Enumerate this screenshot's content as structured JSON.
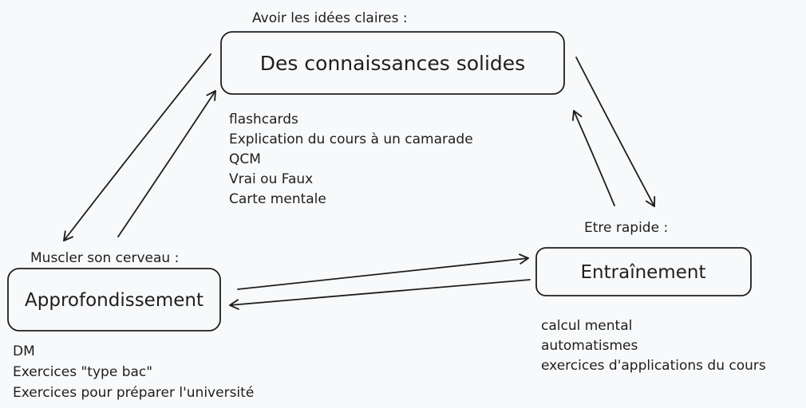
{
  "knowledge": {
    "heading": "Avoir les idées claires :",
    "title": "Des connaissances solides",
    "items": [
      "flashcards",
      "Explication du cours à un camarade",
      "QCM",
      "Vrai ou Faux",
      "Carte mentale"
    ]
  },
  "deepening": {
    "heading": "Muscler son cerveau :",
    "title": "Approfondissement",
    "items": [
      "DM",
      "Exercices \"type bac\"",
      "Exercices pour préparer l'université"
    ]
  },
  "training": {
    "heading": "Etre rapide :",
    "title": "Entraînement",
    "items": [
      "calcul mental",
      "automatismes",
      "exercices d'applications du cours"
    ]
  },
  "colors": {
    "stroke": "#1e1e1e",
    "background": "#f8f9fa"
  }
}
